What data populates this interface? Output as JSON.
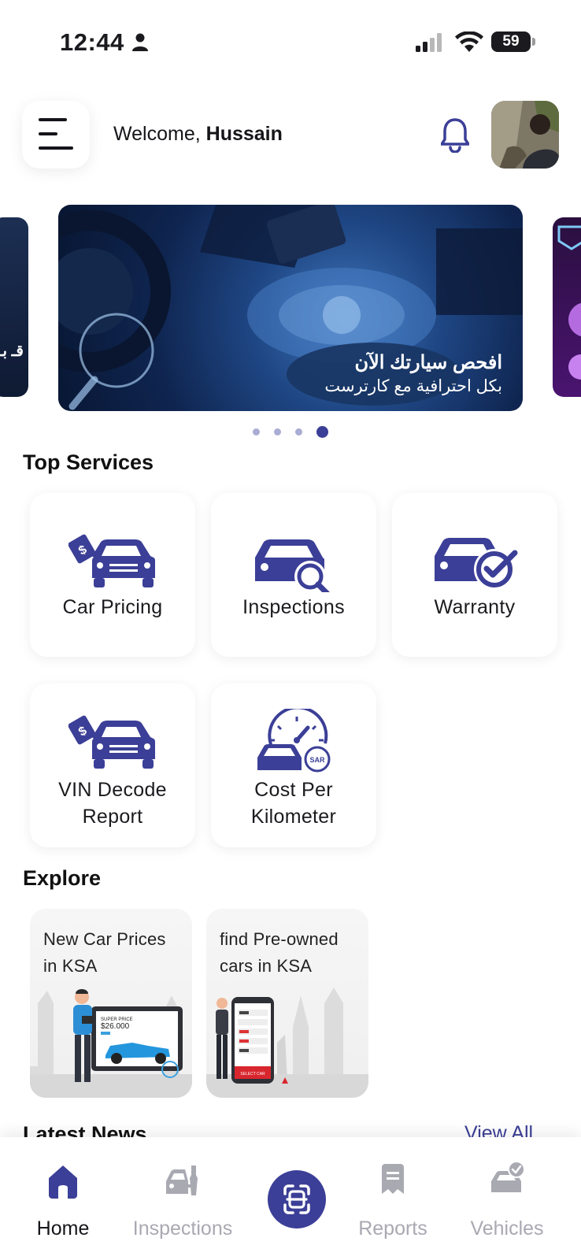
{
  "status_bar": {
    "time": "12:44",
    "battery": "59"
  },
  "header": {
    "welcome_prefix": "Welcome, ",
    "user_name": "Hussain"
  },
  "carousel": {
    "title": "افحص سيارتك الآن",
    "subtitle": "بكل احترافية مع كارترست",
    "side_left_text": "قـ بـ",
    "page_count": 4,
    "active_index": 3
  },
  "top_services": {
    "title": "Top Services",
    "items": [
      {
        "label": "Car Pricing",
        "icon": "car-pricing-icon"
      },
      {
        "label": "Inspections",
        "icon": "car-inspection-icon"
      },
      {
        "label": "Warranty",
        "icon": "car-warranty-icon"
      },
      {
        "label": "VIN Decode Report",
        "line1": "VIN Decode",
        "line2": "Report",
        "icon": "vin-decode-icon"
      },
      {
        "label": "Cost Per Kilometer",
        "line1": "Cost Per",
        "line2": "Kilometer",
        "icon": "cost-per-km-icon"
      }
    ]
  },
  "explore": {
    "title": "Explore",
    "items": [
      {
        "line1": "New Car Prices",
        "line2": "in KSA",
        "illustration_text": "SUPER PRICE",
        "price": "$26.000"
      },
      {
        "line1": "find Pre-owned",
        "line2": "cars in KSA",
        "illustration_text": "SELECT CAR"
      }
    ]
  },
  "latest_news": {
    "title": "Latest News",
    "view_all": "View All"
  },
  "bottom_nav": {
    "items": [
      {
        "label": "Home",
        "icon": "home-icon",
        "active": true
      },
      {
        "label": "Inspections",
        "icon": "inspection-tools-icon",
        "active": false
      },
      {
        "label": "",
        "icon": "scan-icon",
        "active": false
      },
      {
        "label": "Reports",
        "icon": "report-icon",
        "active": false
      },
      {
        "label": "Vehicles",
        "icon": "vehicles-icon",
        "active": false
      }
    ]
  },
  "colors": {
    "accent": "#3b3f97",
    "muted": "#a9a9b2",
    "text": "#1b1b1f"
  }
}
